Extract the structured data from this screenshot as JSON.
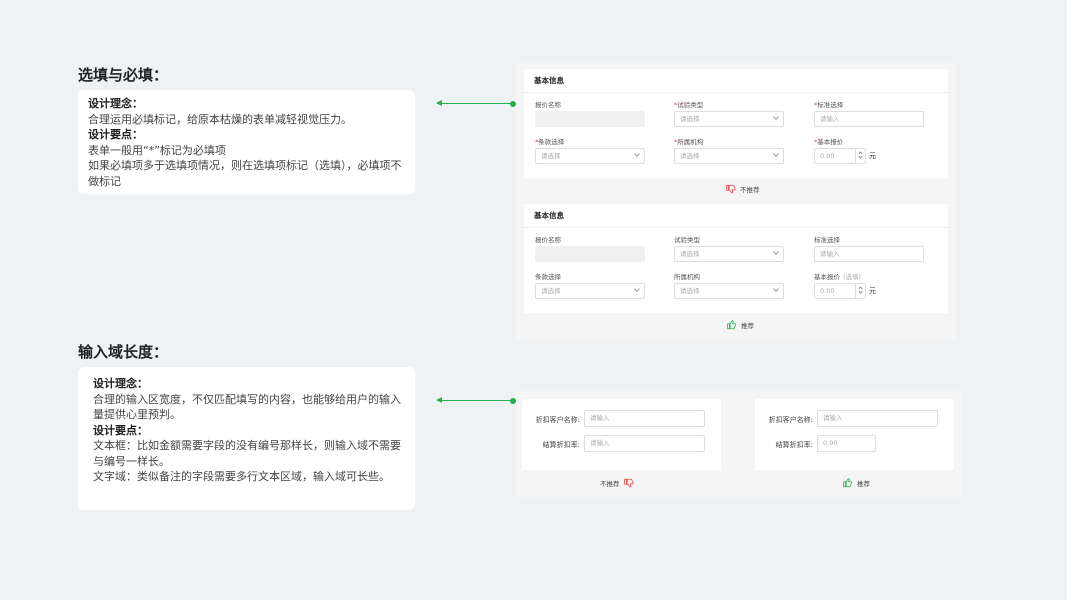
{
  "section1": {
    "title": "选填与必填：",
    "note": {
      "concept_heading": "设计理念：",
      "concept_text": "合理运用必填标记，给原本枯燥的表单减轻视觉压力。",
      "points_heading": "设计要点：",
      "point1": "表单一般用“*”标记为必填项",
      "point2": "如果必填项多于选填项情况，则在选填项标记（选填），必填项不做标记"
    },
    "bad_form": {
      "header": "基本信息",
      "f1_label": "报价名称",
      "f2_req": "*",
      "f2_label": "试验类型",
      "f2_placeholder": "请选择",
      "f3_req": "*",
      "f3_label": "标准选择",
      "f3_placeholder": "请输入",
      "f4_req": "*",
      "f4_label": "条款选择",
      "f4_placeholder": "请选择",
      "f5_req": "*",
      "f5_label": "所属机构",
      "f5_placeholder": "请选择",
      "f6_req": "*",
      "f6_label": "基本报价",
      "f6_value": "0.00",
      "unit": "元",
      "verdict": "不推荐"
    },
    "good_form": {
      "header": "基本信息",
      "f1_label": "报价名称",
      "f2_label": "试验类型",
      "f2_placeholder": "请选择",
      "f3_label": "标准选择",
      "f3_placeholder": "请输入",
      "f4_label": "条款选择",
      "f4_placeholder": "请选择",
      "f5_label": "所属机构",
      "f5_placeholder": "请选择",
      "f6_label": "基本报价",
      "f6_optional": "(选填)",
      "f6_value": "0.00",
      "unit": "元",
      "verdict": "推荐"
    }
  },
  "section2": {
    "title": "输入域长度：",
    "note": {
      "concept_heading": "设计理念：",
      "concept_text": "合理的输入区宽度，不仅匹配填写的内容，也能够给用户的输入量提供心里预判。",
      "points_heading": "设计要点：",
      "point1": "文本框：比如金额需要字段的没有编号那样长，则输入域不需要与编号一样长。",
      "point2": "文字域：类似备注的字段需要多行文本区域，输入域可长些。"
    },
    "bad_form": {
      "label1": "折扣客户名称:",
      "placeholder1": "请输入",
      "label2": "结算折扣率:",
      "placeholder2": "请输入",
      "verdict": "不推荐"
    },
    "good_form": {
      "label1": "折扣客户名称:",
      "placeholder1": "请输入",
      "label2": "结算折扣率:",
      "value2": "0.00",
      "verdict": "推荐"
    }
  },
  "colors": {
    "accent_green": "#22b14c",
    "required_red": "#e84343",
    "background": "#eef2f5"
  },
  "icons": {
    "thumbs_down": "thumbs-down-icon",
    "thumbs_up": "thumbs-up-icon"
  }
}
